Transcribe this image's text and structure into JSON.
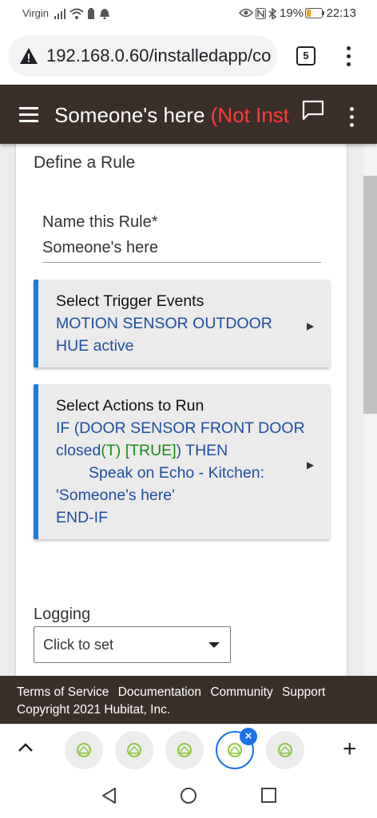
{
  "status_bar": {
    "carrier": "Virgin",
    "battery_pct": "19%",
    "time": "22:13"
  },
  "browser": {
    "url": "192.168.0.60/installedapp/co",
    "tab_count": "5"
  },
  "app_header": {
    "title": "Someone's here",
    "status": "(Not Inst"
  },
  "page": {
    "section_title": "Define a Rule",
    "name_label": "Name this Rule*",
    "name_value": "Someone's here",
    "trigger": {
      "title": "Select Trigger Events",
      "line1": "MOTION SENSOR OUTDOOR",
      "line2": "HUE active"
    },
    "actions": {
      "title": "Select Actions to Run",
      "line1": "IF (DOOR SENSOR FRONT DOOR",
      "line2_a": "closed",
      "line2_b": "(T) [TRUE]",
      "line2_c": ") THEN",
      "line3": "Speak on Echo - Kitchen:",
      "line4": "'Someone's here'",
      "line5": "END-IF"
    },
    "logging_label": "Logging",
    "logging_select_value": "Click to set"
  },
  "footer": {
    "links": [
      "Terms of Service",
      "Documentation",
      "Community",
      "Support"
    ],
    "copyright": "Copyright 2021 Hubitat, Inc."
  },
  "colors": {
    "header_bg": "#3b2f2a",
    "accent_blue": "#1e7bd7",
    "link_blue": "#1d4e9e",
    "true_green": "#1a8a1a",
    "not_installed_red": "#ff3b3b"
  }
}
